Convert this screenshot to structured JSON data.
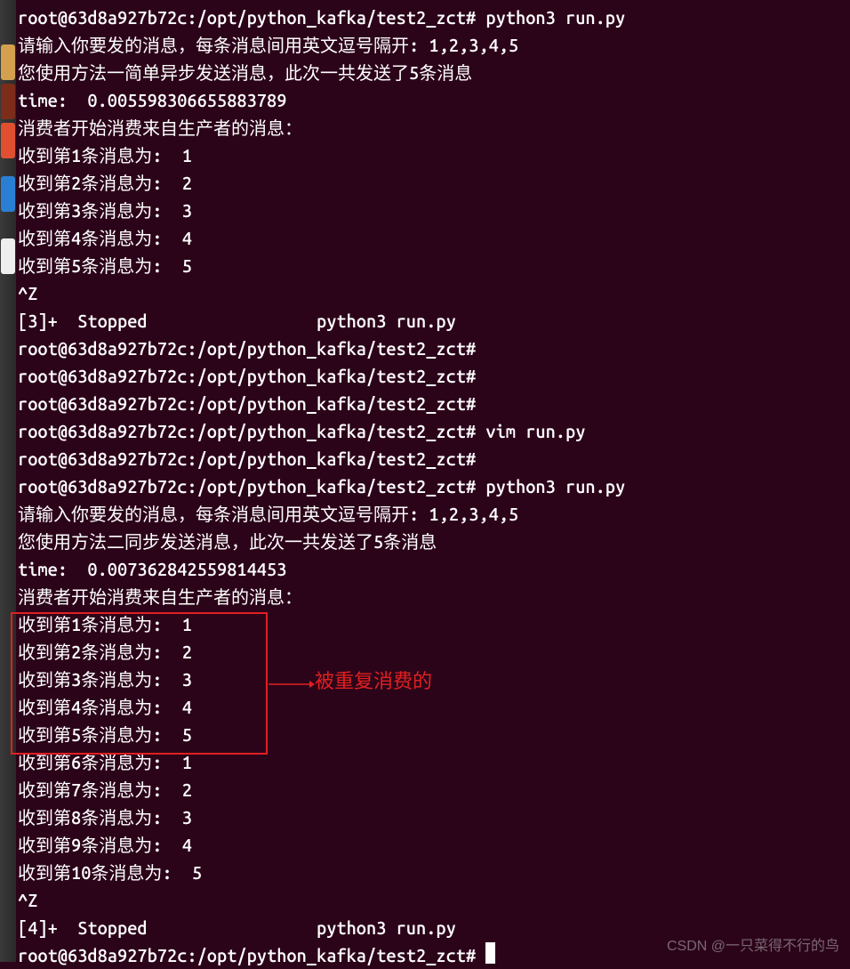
{
  "sidebar_icons": [
    "si1",
    "si2",
    "si3",
    "si4",
    "si5"
  ],
  "terminal": {
    "lines": [
      "root@63d8a927b72c:/opt/python_kafka/test2_zct# python3 run.py",
      "请输入你要发的消息，每条消息间用英文逗号隔开: 1,2,3,4,5",
      "您使用方法一简单异步发送消息，此次一共发送了5条消息",
      "time:  0.005598306655883789",
      "消费者开始消费来自生产者的消息：",
      "收到第1条消息为:  1",
      "收到第2条消息为:  2",
      "收到第3条消息为:  3",
      "收到第4条消息为:  4",
      "收到第5条消息为:  5",
      "^Z",
      "[3]+  Stopped                 python3 run.py",
      "root@63d8a927b72c:/opt/python_kafka/test2_zct#",
      "root@63d8a927b72c:/opt/python_kafka/test2_zct#",
      "root@63d8a927b72c:/opt/python_kafka/test2_zct#",
      "root@63d8a927b72c:/opt/python_kafka/test2_zct# vim run.py",
      "root@63d8a927b72c:/opt/python_kafka/test2_zct#",
      "root@63d8a927b72c:/opt/python_kafka/test2_zct# python3 run.py",
      "请输入你要发的消息，每条消息间用英文逗号隔开: 1,2,3,4,5",
      "您使用方法二同步发送消息，此次一共发送了5条消息",
      "time:  0.007362842559814453",
      "消费者开始消费来自生产者的消息：",
      "收到第1条消息为:  1",
      "收到第2条消息为:  2",
      "收到第3条消息为:  3",
      "收到第4条消息为:  4",
      "收到第5条消息为:  5",
      "收到第6条消息为:  1",
      "收到第7条消息为:  2",
      "收到第8条消息为:  3",
      "收到第9条消息为:  4",
      "收到第10条消息为:  5",
      "^Z",
      "[4]+  Stopped                 python3 run.py"
    ],
    "last_line_prefix": "root@63d8a927b72c:/opt/python_kafka/test2_zct# "
  },
  "annotation": {
    "label": "被重复消费的"
  },
  "watermark": "CSDN @一只菜得不行的鸟"
}
